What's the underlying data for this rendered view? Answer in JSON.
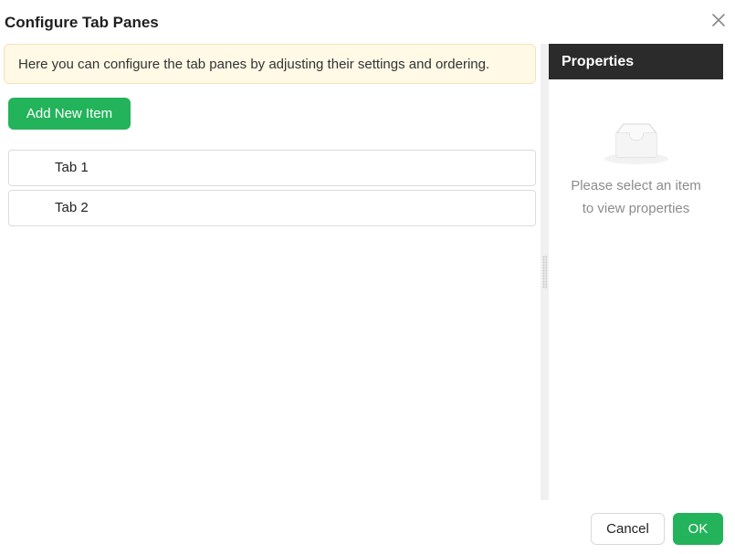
{
  "dialog": {
    "title": "Configure Tab Panes",
    "close_icon": "close-icon"
  },
  "info": {
    "text": "Here you can configure the tab panes by adjusting their settings and ordering."
  },
  "toolbar": {
    "add_label": "Add New Item"
  },
  "tabs": [
    {
      "label": "Tab 1"
    },
    {
      "label": "Tab 2"
    }
  ],
  "properties": {
    "header": "Properties",
    "empty_icon": "empty-inbox-icon",
    "empty_line1": "Please select an item",
    "empty_line2": "to view properties"
  },
  "footer": {
    "cancel_label": "Cancel",
    "ok_label": "OK"
  },
  "colors": {
    "accent": "#23b35b",
    "info_bg": "#fff9e6",
    "header_bg": "#2b2b2b"
  }
}
